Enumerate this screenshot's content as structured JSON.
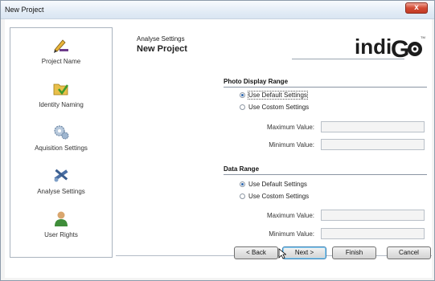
{
  "window": {
    "title": "New Project",
    "close_glyph": "x"
  },
  "nav": {
    "items": [
      {
        "label": "Project Name",
        "icon": "pen-icon"
      },
      {
        "label": "Identity Naming",
        "icon": "folder-icon"
      },
      {
        "label": "Aquisition Settings",
        "icon": "gears-icon"
      },
      {
        "label": "Analyse Settings",
        "icon": "tools-icon"
      },
      {
        "label": "User Rights",
        "icon": "user-icon"
      }
    ]
  },
  "header": {
    "subtitle": "Analyse Settings",
    "title": "New Project",
    "logo_text": "indiGO"
  },
  "photo_display_range": {
    "title": "Photo Display Range",
    "options": [
      {
        "label": "Use Default Settings",
        "selected": true
      },
      {
        "label": "Use Costom Settings",
        "selected": false
      }
    ],
    "max_label": "Maximum Value:",
    "min_label": "Minimum Value:",
    "max_value": "",
    "min_value": ""
  },
  "data_range": {
    "title": "Data Range",
    "options": [
      {
        "label": "Use Default Settings",
        "selected": true
      },
      {
        "label": "Use Costom Settings",
        "selected": false
      }
    ],
    "max_label": "Maximum Value:",
    "min_label": "Minimum Value:",
    "max_value": "",
    "min_value": ""
  },
  "buttons": {
    "back": "< Back",
    "next": "Next >",
    "finish": "Finish",
    "cancel": "Cancel"
  },
  "colors": {
    "accent": "#2e68b0",
    "title_bar": "#dfe9f5",
    "close": "#c9432d"
  }
}
